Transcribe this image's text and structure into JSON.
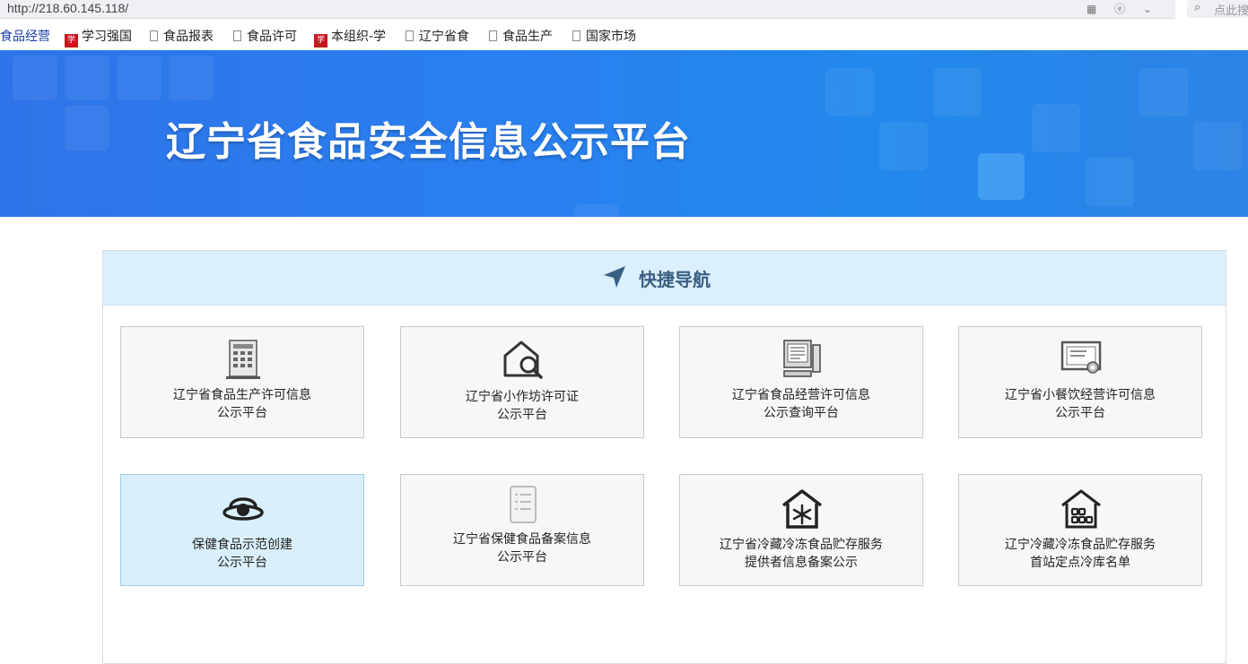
{
  "browser": {
    "url": "http://218.60.145.118/",
    "search_placeholder": "点此搜",
    "addr_icons": "▦ ⓔ ⌄"
  },
  "bookmarks": [
    {
      "label": "食品经营",
      "icon": "none"
    },
    {
      "label": "学习强国",
      "icon": "red-logo"
    },
    {
      "label": "食品报表",
      "icon": "doc"
    },
    {
      "label": "食品许可",
      "icon": "doc"
    },
    {
      "label": "本组织-学",
      "icon": "red-logo"
    },
    {
      "label": "辽宁省食",
      "icon": "doc"
    },
    {
      "label": "食品生产",
      "icon": "doc"
    },
    {
      "label": "国家市场",
      "icon": "doc"
    }
  ],
  "banner": {
    "title": "辽宁省食品安全信息公示平台"
  },
  "nav": {
    "title": "快捷导航",
    "cards": [
      {
        "line1": "辽宁省食品生产许可信息",
        "line2": "公示平台",
        "icon": "building-icon"
      },
      {
        "line1": "辽宁省小作坊许可证",
        "line2": "公示平台",
        "icon": "house-search-icon"
      },
      {
        "line1": "辽宁省食品经营许可信息",
        "line2": "公示查询平台",
        "icon": "computer-icon"
      },
      {
        "line1": "辽宁省小餐饮经营许可信息",
        "line2": "公示平台",
        "icon": "certificate-icon"
      },
      {
        "line1": "保健食品示范创建",
        "line2": "公示平台",
        "icon": "shield-icon"
      },
      {
        "line1": "辽宁省保健食品备案信息",
        "line2": "公示平台",
        "icon": "document-list-icon"
      },
      {
        "line1": "辽宁省冷藏冷冻食品贮存服务",
        "line2": "提供者信息备案公示",
        "icon": "snowflake-house-icon"
      },
      {
        "line1": "辽宁冷藏冷冻食品贮存服务",
        "line2": "首站定点冷库名单",
        "icon": "warehouse-icon"
      }
    ]
  },
  "colors": {
    "banner": "#2a7ff0",
    "nav_head": "#dbf0fc",
    "nav_title": "#3a5f84",
    "card_active": "#d9f0fc"
  }
}
